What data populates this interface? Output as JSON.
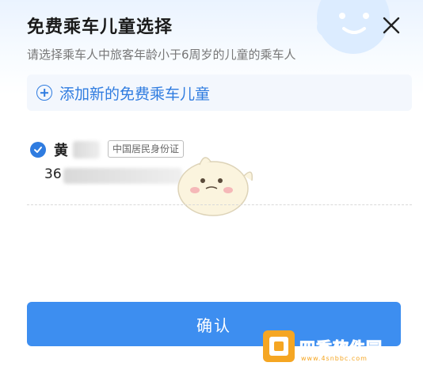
{
  "dialog": {
    "title": "免费乘车儿童选择",
    "subtitle": "请选择乘车人中旅客年龄小于6周岁的儿童的乘车人",
    "close_icon": "close-icon"
  },
  "add_child": {
    "label": "添加新的免费乘车儿童",
    "icon": "plus-circle-icon"
  },
  "passengers": [
    {
      "name": "黄",
      "id_type": "中国居民身份证",
      "id_number": "36",
      "selected": true
    }
  ],
  "confirm": {
    "label": "确认"
  },
  "watermark": {
    "text": "四季软件园",
    "url": "www.4snbbc.com"
  },
  "colors": {
    "accent": "#2f7ce0",
    "button": "#3d8ef0",
    "title": "#1a1a1a",
    "subtitle": "#777777"
  }
}
